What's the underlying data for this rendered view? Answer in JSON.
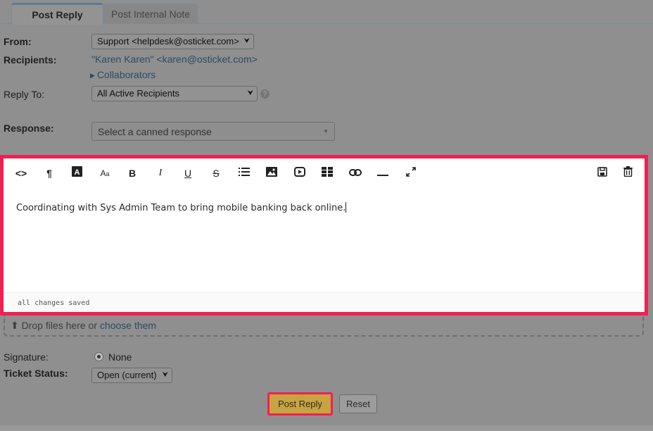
{
  "tabs": [
    {
      "label": "Post Reply",
      "active": true
    },
    {
      "label": "Post Internal Note",
      "active": false
    }
  ],
  "form": {
    "from_label": "From:",
    "from_value": "Support <helpdesk@osticket.com>",
    "recipients_label": "Recipients:",
    "recipients_value": "\"Karen Karen\" <karen@osticket.com>",
    "collaborators_label": "Collaborators",
    "reply_to_label": "Reply To:",
    "reply_to_value": "All Active Recipients",
    "response_label": "Response:",
    "response_placeholder": "Select a canned response"
  },
  "editor": {
    "toolbar": [
      "html-code-icon",
      "paragraph-icon",
      "font-color-icon",
      "font-size-icon",
      "bold-icon",
      "italic-icon",
      "underline-icon",
      "strikethrough-icon",
      "list-icon",
      "image-icon",
      "video-icon",
      "table-icon",
      "link-icon",
      "horizontal-rule-icon",
      "fullscreen-icon",
      "save-draft-icon",
      "delete-draft-icon"
    ],
    "content": "Coordinating with Sys Admin Team to bring mobile banking back online.",
    "status": "all changes saved",
    "highlight_color": "#f21f52"
  },
  "attachments": {
    "drop_text": "Drop files here or",
    "choose_link": "choose them"
  },
  "signature": {
    "label": "Signature:",
    "value": "None"
  },
  "ticket_status": {
    "label": "Ticket Status:",
    "value": "Open (current)"
  },
  "actions": {
    "post_reply": "Post Reply",
    "reset": "Reset"
  },
  "colors": {
    "accent": "#f21f52",
    "primary_button": "#c7a441",
    "link": "#2d4a66"
  }
}
